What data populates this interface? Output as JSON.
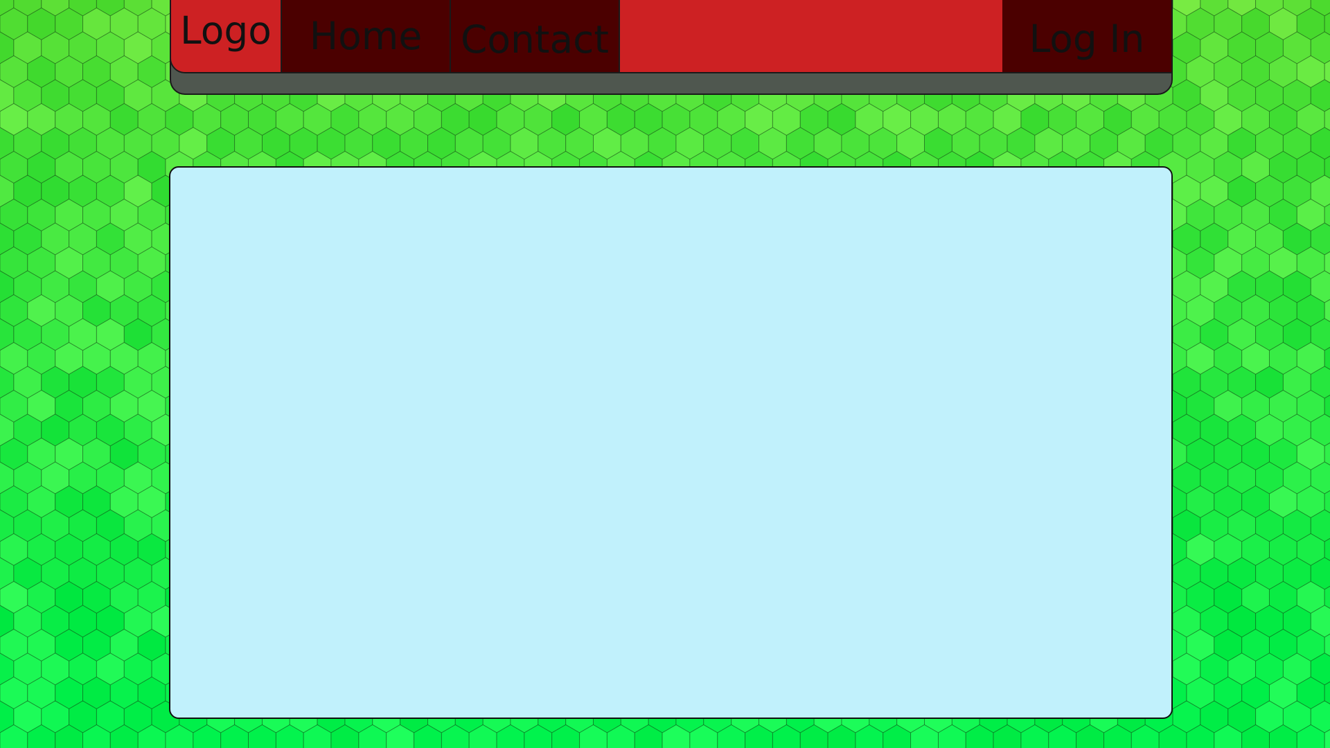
{
  "nav": {
    "logo": "Logo",
    "home": "Home",
    "contact": "Contact",
    "login": "Log In"
  },
  "colors": {
    "nav_red": "#cd2123",
    "nav_dark": "#4b0000",
    "nav_shadow": "#4f574f",
    "content_bg": "#c1f1fc",
    "background_green": "#3fee40"
  },
  "content": {}
}
